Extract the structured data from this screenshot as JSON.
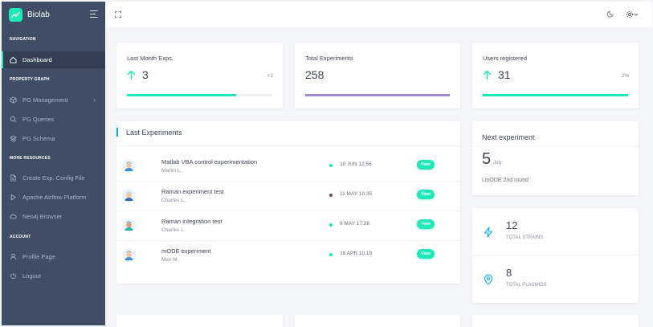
{
  "brand": {
    "name": "Biolab"
  },
  "sidebar": {
    "sections": [
      {
        "caption": "NAVIGATION",
        "items": [
          {
            "label": "Dashboard",
            "icon": "home-icon",
            "active": true
          }
        ]
      },
      {
        "caption": "PROPERTY GRAPH",
        "items": [
          {
            "label": "PG Management",
            "icon": "box-icon",
            "has_submenu": true
          },
          {
            "label": "PG Queries",
            "icon": "search-icon"
          },
          {
            "label": "PG Schema",
            "icon": "layers-icon"
          }
        ]
      },
      {
        "caption": "MORE RESOURCES",
        "items": [
          {
            "label": "Create Exp. Config File",
            "icon": "file-icon"
          },
          {
            "label": "Apache Airflow Platform",
            "icon": "play-icon"
          },
          {
            "label": "Neo4j Browser",
            "icon": "cloud-icon"
          }
        ]
      },
      {
        "caption": "ACCOUNT",
        "items": [
          {
            "label": "Profile Page",
            "icon": "user-icon"
          },
          {
            "label": "Logout",
            "icon": "power-icon"
          }
        ]
      }
    ]
  },
  "stats": [
    {
      "title": "Last Month Exps.",
      "value": "3",
      "extra": "+2",
      "trend": "up",
      "progress": 0.75,
      "color": "#1de9b6"
    },
    {
      "title": "Total Experiments",
      "value": "258",
      "extra": "",
      "trend": "",
      "progress": 1.0,
      "color": "#a389d4"
    },
    {
      "title": "Users registered",
      "value": "31",
      "extra": "2%",
      "trend": "up",
      "progress": 1.0,
      "color": "#1de9b6"
    }
  ],
  "last_experiments": {
    "title": "Last Experiments",
    "rows": [
      {
        "name": "Matlab VBA control experimentation",
        "user": "Martin L.",
        "date": "10 JUN 12:56",
        "status_color": "#1de9b6",
        "action": "View"
      },
      {
        "name": "Raman experiment test",
        "user": "Charles L.",
        "date": "11 MAY 10:35",
        "status_color": "#7a4b3a",
        "action": "View"
      },
      {
        "name": "Raman integration test",
        "user": "Charles L.",
        "date": "9 MAY 17:38",
        "status_color": "#1de9b6",
        "action": "View"
      },
      {
        "name": "mODE experiment",
        "user": "Max M.",
        "date": "19 APR 10:19",
        "status_color": "#1de9b6",
        "action": "View"
      }
    ]
  },
  "next_experiment": {
    "title": "Next experiment",
    "day": "5",
    "month": "July",
    "description": "LinODE 2nd round"
  },
  "totals": [
    {
      "value": "12",
      "label": "TOTAL STRAINS",
      "icon": "lightning-icon"
    },
    {
      "value": "8",
      "label": "TOTAL PLASMIDS",
      "icon": "map-pin-icon"
    }
  ],
  "colors": {
    "accent": "#1de9b6",
    "sidebar_bg": "#3f4d67",
    "link_blue": "#04a9f5"
  }
}
